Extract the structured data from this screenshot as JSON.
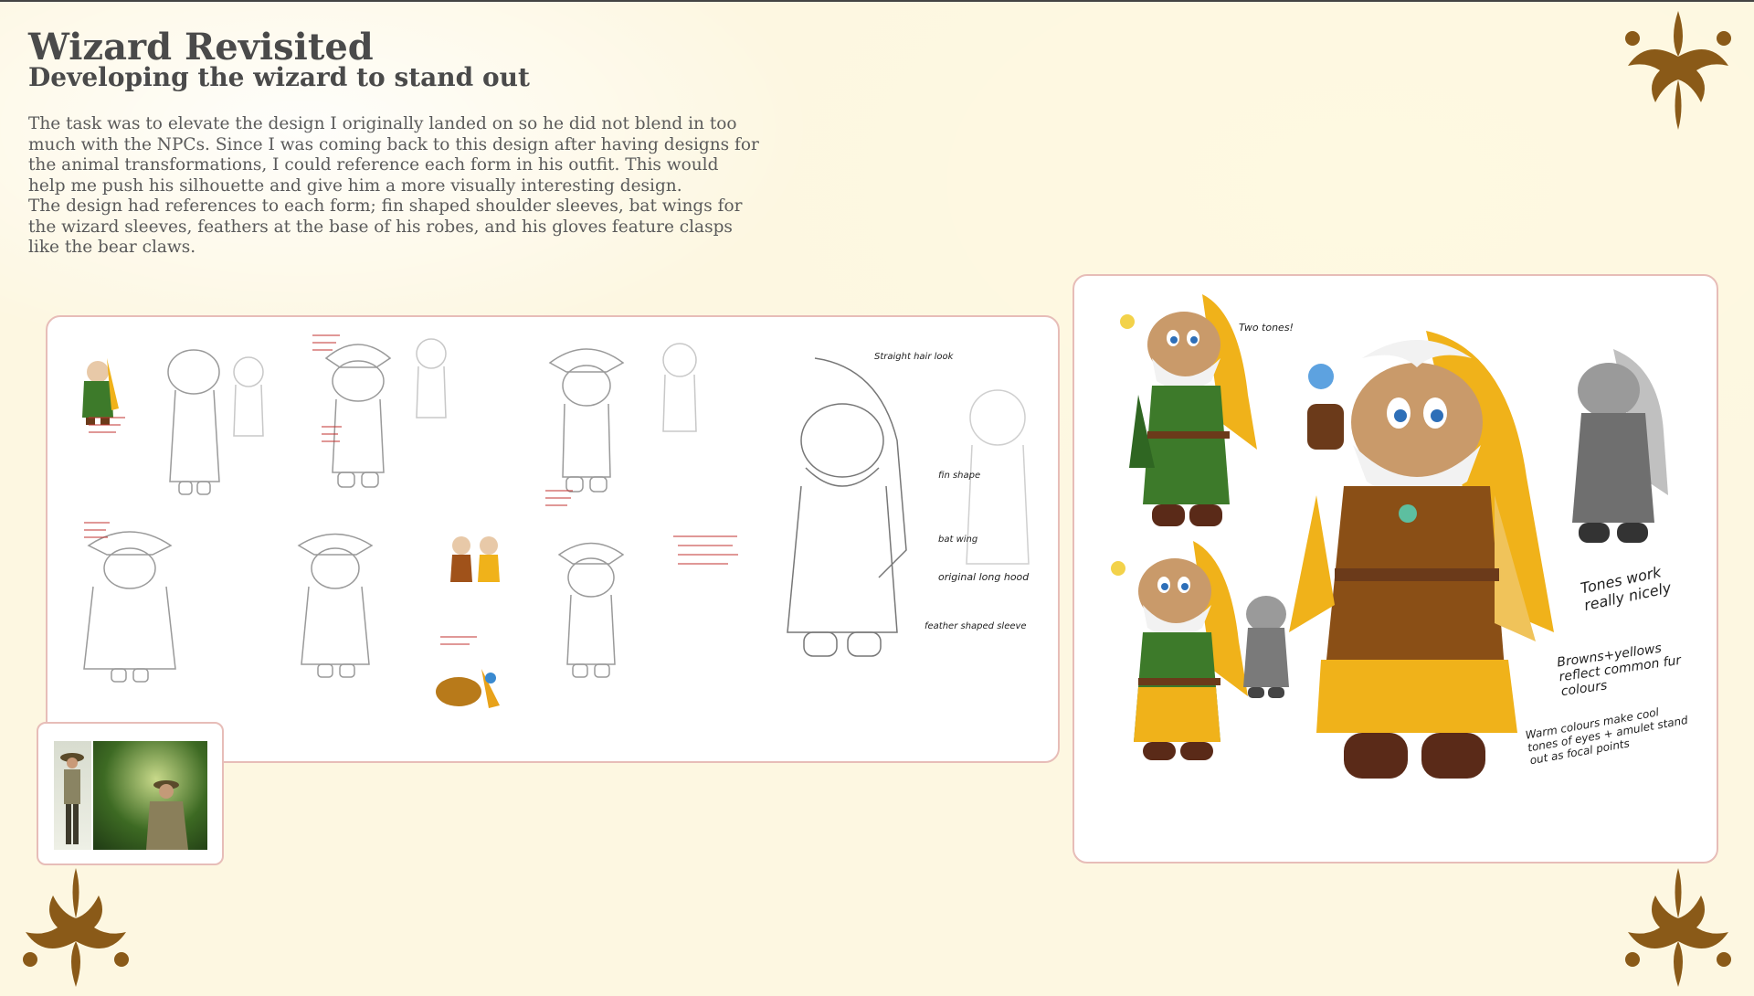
{
  "header": {
    "title": "Wizard Revisited",
    "subtitle": "Developing the wizard to stand out"
  },
  "body": {
    "paragraph1": "The task was to elevate the design I originally landed on so he did not blend in too much with the NPCs. Since I was coming back to this design after having designs for the animal transformations, I could reference each form in his outfit. This would help me push his silhouette and give him a more visually interesting design.",
    "paragraph2": "The design had references to each form; fin shaped shoulder sleeves, bat wings for the wizard sleeves, feathers at the base of his robes, and his gloves feature clasps like the bear claws."
  },
  "sketch_annotations": {
    "straight_hair": "Straight hair look",
    "fin_shape": "fin shape",
    "bat_wing": "bat wing",
    "original_long_hood": "original long hood",
    "feather_shaped_sleeve": "feather shaped sleeve"
  },
  "color_annotations": {
    "tones_label": "Tones work really nicely",
    "browns_yellows": "Browns+yellows reflect common fur colours",
    "warm_colours": "Warm colours make cool tones of eyes + amulet stand out as focal points",
    "two_tones": "Two tones!"
  },
  "colors": {
    "background": "#fdf7e1",
    "panel_border": "#e7bdb8",
    "ornament": "#8a5a18",
    "heading": "#4a4a4a",
    "robe_brown": "#8a4f16",
    "robe_yellow": "#f0b21a",
    "robe_green": "#3d7a2a"
  },
  "ornaments": [
    "fleur-ornament-top-right",
    "fleur-ornament-bottom-left",
    "fleur-ornament-bottom-right"
  ]
}
